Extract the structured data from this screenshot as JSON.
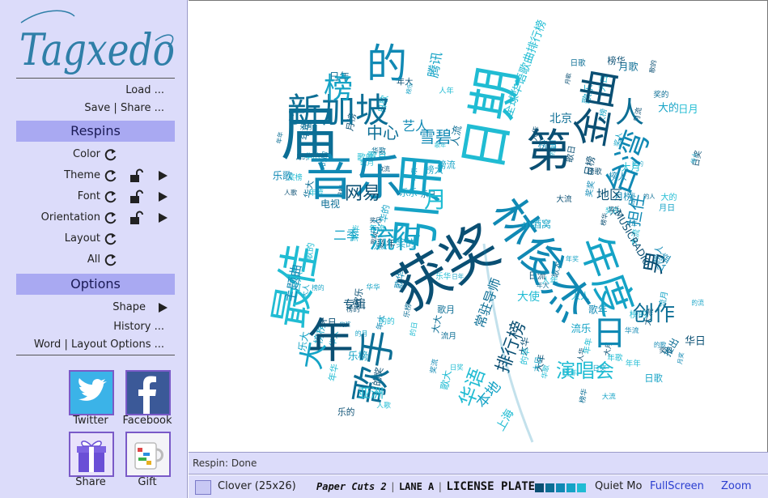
{
  "app": {
    "logo_text": "Tagxedo"
  },
  "menu": {
    "load": "Load ...",
    "save": "Save",
    "divider": "|",
    "share": "Share ..."
  },
  "respins": {
    "title": "Respins",
    "rows": [
      {
        "label": "Color"
      },
      {
        "label": "Theme"
      },
      {
        "label": "Font"
      },
      {
        "label": "Orientation"
      },
      {
        "label": "Layout"
      },
      {
        "label": "All"
      }
    ]
  },
  "options": {
    "title": "Options",
    "shape": "Shape",
    "history": "History ...",
    "word": "Word",
    "divider": "|",
    "layout_options": "Layout Options ..."
  },
  "share_tiles": [
    {
      "label": "Twitter"
    },
    {
      "label": "Facebook"
    },
    {
      "label": "Share"
    },
    {
      "label": "Gift"
    }
  ],
  "status": {
    "text": "Respin: Done"
  },
  "toolbar": {
    "shape_name": "Clover (25x26)",
    "fonts": [
      "Paper Cuts 2",
      "LANE A",
      "LICENSE PLATE"
    ],
    "sep": "|",
    "palette": [
      "#0a4f73",
      "#0c6e95",
      "#1089b4",
      "#15a3c6",
      "#20bcd3"
    ],
    "theme_name": "Quiet Mo",
    "fullscreen": "FullScreen",
    "zoom": "Zoom"
  },
  "cloud": {
    "words": [
      "获奖",
      "届",
      "音乐",
      "引用",
      "日期",
      "第",
      "新加坡",
      "的",
      "榜",
      "最佳",
      "年",
      "歌手",
      "林俊杰",
      "年度",
      "演唱会",
      "金曲",
      "人",
      "台湾",
      "流行",
      "华语",
      "男",
      "创作",
      "日",
      "大",
      "月",
      "网易",
      "中心",
      "艺人",
      "腾讯",
      "全球华语歌曲排行榜",
      "排行榜",
      "常驻导师",
      "担任",
      "本地",
      "上海",
      "地区",
      "北京",
      "雪碧",
      "小酒窝",
      "大使",
      "MUSICRADIO",
      "电视",
      "主题曲",
      "二季",
      "亚洲",
      "专辑",
      "推出",
      "公益"
    ],
    "colors": [
      "#0a4f73",
      "#0c6e95",
      "#1089b4",
      "#15a3c6",
      "#20bcd3"
    ]
  }
}
